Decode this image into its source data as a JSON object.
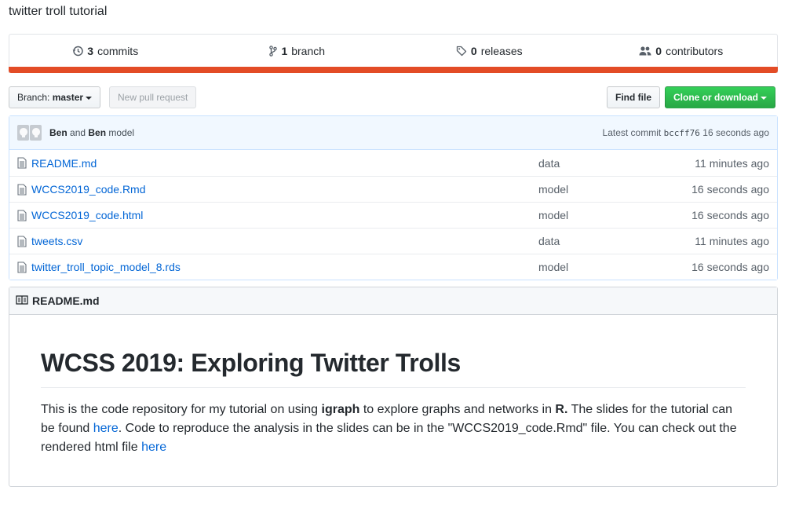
{
  "repo": {
    "description": "twitter troll tutorial"
  },
  "summary": {
    "commits_count": "3",
    "commits_label": "commits",
    "branches_count": "1",
    "branches_label": "branch",
    "releases_count": "0",
    "releases_label": "releases",
    "contributors_count": "0",
    "contributors_label": "contributors",
    "language_color": "#e34c26"
  },
  "toolbar": {
    "branch_prefix": "Branch:",
    "branch_name": "master",
    "new_pr_label": "New pull request",
    "find_file_label": "Find file",
    "clone_label": "Clone or download"
  },
  "commit": {
    "author1": "Ben",
    "joiner": "and",
    "author2": "Ben",
    "message": "model",
    "latest_label": "Latest commit",
    "sha": "bccff76",
    "age": "16 seconds ago"
  },
  "files": [
    {
      "name": "README.md",
      "message": "data",
      "age": "11 minutes ago"
    },
    {
      "name": "WCCS2019_code.Rmd",
      "message": "model",
      "age": "16 seconds ago"
    },
    {
      "name": "WCCS2019_code.html",
      "message": "model",
      "age": "16 seconds ago"
    },
    {
      "name": "tweets.csv",
      "message": "data",
      "age": "11 minutes ago"
    },
    {
      "name": "twitter_troll_topic_model_8.rds",
      "message": "model",
      "age": "16 seconds ago"
    }
  ],
  "readme": {
    "header": "README.md",
    "title": "WCSS 2019: Exploring Twitter Trolls",
    "p_part1": "This is the code repository for my tutorial on using ",
    "p_bold1": "igraph",
    "p_part2": " to explore graphs and networks in ",
    "p_bold2": "R.",
    "p_part3": " The slides for the tutorial can be found ",
    "p_link1": "here",
    "p_part4": ". Code to reproduce the analysis in the slides can be in the \"WCCS2019_code.Rmd\" file. You can check out the rendered html file ",
    "p_link2": "here"
  }
}
